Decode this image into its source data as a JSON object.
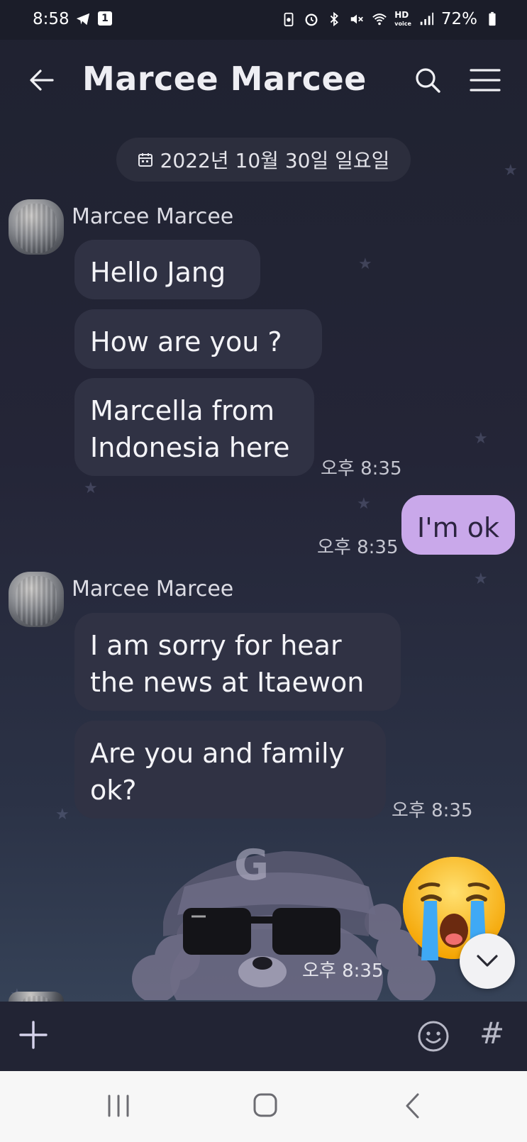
{
  "status_bar": {
    "time": "8:58",
    "notification_badge": "1",
    "network": "HD",
    "network_sub": "voice",
    "battery": "72%"
  },
  "header": {
    "title": "Marcee Marcee"
  },
  "date_chip": {
    "text": "2022년 10월 30일 일요일"
  },
  "messages": {
    "group1": {
      "sender": "Marcee Marcee",
      "bubbles": [
        "Hello Jang",
        "How are you ?",
        "Marcella from\nIndonesia here"
      ],
      "time": "오후 8:35"
    },
    "me1": {
      "text": "I'm ok",
      "time": "오후 8:35"
    },
    "group2": {
      "sender": "Marcee Marcee",
      "bubbles": [
        "I am sorry for hear\nthe news at Itaewon",
        "Are you and family\nok?"
      ],
      "time": "오후 8:35"
    },
    "sticker": {
      "time": "오후 8:35"
    }
  },
  "input_bar": {
    "hash_label": "#"
  },
  "colors": {
    "background": "#1f2231",
    "bubble_other": "#303244",
    "bubble_me": "#c9a8ea",
    "date_chip": "#2c2e3d",
    "input_bar": "#222434",
    "nav_bar": "#f7f7f7"
  },
  "icons": [
    "back-arrow-icon",
    "search-icon",
    "menu-icon",
    "calendar-icon",
    "plus-icon",
    "emoji-icon",
    "hash-icon",
    "chevron-down-icon",
    "nav-recents-icon",
    "nav-home-icon",
    "nav-back-icon"
  ]
}
